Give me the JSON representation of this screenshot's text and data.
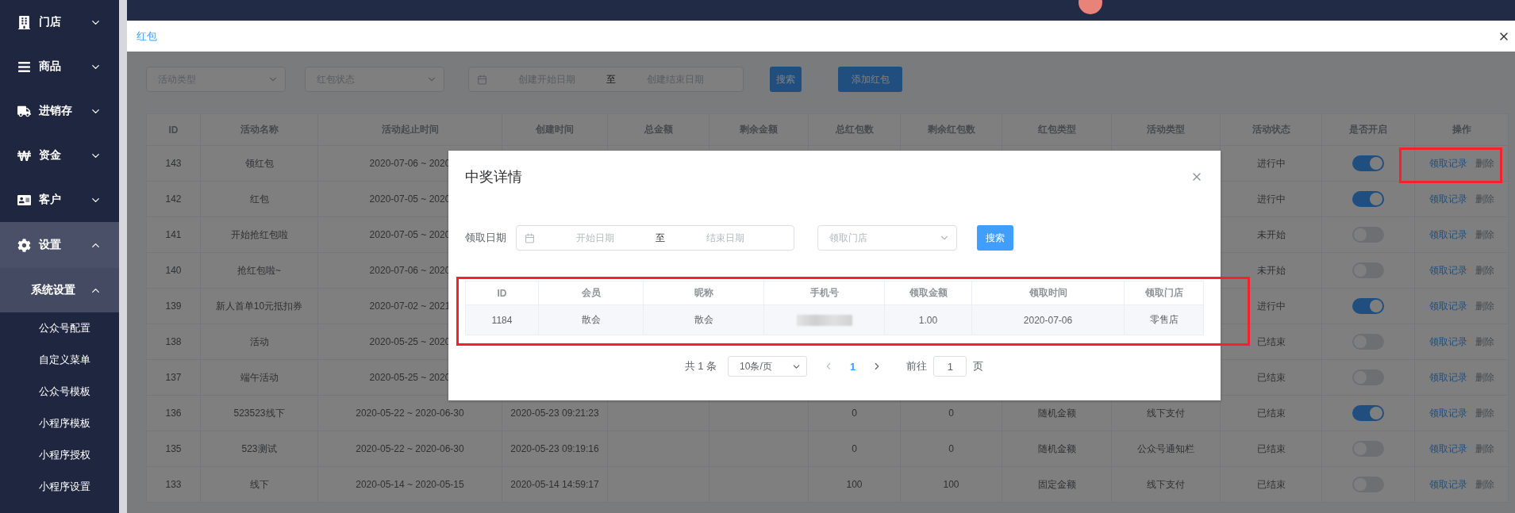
{
  "sidebar": {
    "items": [
      {
        "label": "门店",
        "expanded": false
      },
      {
        "label": "商品",
        "expanded": false
      },
      {
        "label": "进销存",
        "expanded": false
      },
      {
        "label": "资金",
        "expanded": false
      },
      {
        "label": "客户",
        "expanded": false
      },
      {
        "label": "设置",
        "expanded": true,
        "children": [
          {
            "label": "系统设置",
            "expanded": true,
            "children": [
              {
                "label": "公众号配置"
              },
              {
                "label": "自定义菜单"
              },
              {
                "label": "公众号模板"
              },
              {
                "label": "小程序模板"
              },
              {
                "label": "小程序授权"
              },
              {
                "label": "小程序设置"
              }
            ]
          }
        ]
      }
    ]
  },
  "page_title": "红包",
  "filters": {
    "activity_type": {
      "placeholder": "活动类型"
    },
    "packet_status": {
      "placeholder": "红包状态"
    },
    "date_range": {
      "start_placeholder": "创建开始日期",
      "separator": "至",
      "end_placeholder": "创建结束日期"
    },
    "buttons": [
      "搜索",
      "添加红包"
    ]
  },
  "table": {
    "columns": [
      "ID",
      "活动名称",
      "活动起止时间",
      "创建时间",
      "总金额",
      "剩余金额",
      "总红包数",
      "剩余红包数",
      "红包类型",
      "活动类型",
      "活动状态",
      "是否开启",
      "操作"
    ],
    "rows": [
      {
        "cells": [
          "143",
          "领红包",
          "2020-07-06 ~ 2020",
          null,
          null,
          null,
          null,
          null,
          null,
          null,
          "进行中"
        ],
        "enabled": true,
        "actions": [
          "领取记录",
          "删除"
        ]
      },
      {
        "cells": [
          "142",
          "红包",
          "2020-07-05 ~ 2020",
          null,
          null,
          null,
          null,
          null,
          null,
          null,
          "进行中"
        ],
        "enabled": true,
        "actions": [
          "领取记录",
          "删除"
        ]
      },
      {
        "cells": [
          "141",
          "开始抢红包啦",
          "2020-07-05 ~ 2020",
          null,
          null,
          null,
          null,
          null,
          null,
          null,
          "未开始"
        ],
        "enabled": false,
        "actions": [
          "领取记录",
          "删除"
        ]
      },
      {
        "cells": [
          "140",
          "抢红包啦~",
          "2020-07-06 ~ 2020",
          null,
          null,
          null,
          null,
          null,
          null,
          null,
          "未开始"
        ],
        "enabled": false,
        "actions": [
          "领取记录",
          "删除"
        ]
      },
      {
        "cells": [
          "139",
          "新人首单10元抵扣券",
          "2020-07-02 ~ 2021",
          null,
          null,
          null,
          null,
          null,
          null,
          null,
          "进行中"
        ],
        "enabled": true,
        "actions": [
          "领取记录",
          "删除"
        ]
      },
      {
        "cells": [
          "138",
          "活动",
          "2020-05-25 ~ 2020",
          null,
          null,
          null,
          null,
          null,
          null,
          null,
          "已结束"
        ],
        "enabled": false,
        "actions": [
          "领取记录",
          "删除"
        ]
      },
      {
        "cells": [
          "137",
          "端午活动",
          "2020-05-25 ~ 2020",
          null,
          null,
          null,
          null,
          null,
          null,
          null,
          "已结束"
        ],
        "enabled": false,
        "actions": [
          "领取记录",
          "删除"
        ]
      },
      {
        "cells": [
          "136",
          "523523线下",
          "2020-05-22 ~ 2020-06-30",
          "2020-05-23 09:21:23",
          null,
          null,
          "0",
          "0",
          "随机金额",
          "线下支付",
          "已结束"
        ],
        "enabled": true,
        "actions": [
          "领取记录",
          "删除"
        ]
      },
      {
        "cells": [
          "135",
          "523测试",
          "2020-05-22 ~ 2020-06-30",
          "2020-05-23 09:19:16",
          null,
          null,
          "0",
          "0",
          "随机金额",
          "公众号通知栏",
          "已结束"
        ],
        "enabled": false,
        "actions": [
          "领取记录",
          "删除"
        ]
      },
      {
        "cells": [
          "133",
          "线下",
          "2020-05-14 ~ 2020-05-15",
          "2020-05-14 14:59:17",
          null,
          null,
          "100",
          "100",
          "固定金额",
          "线下支付",
          "已结束"
        ],
        "enabled": false,
        "actions": [
          "领取记录",
          "删除"
        ]
      }
    ]
  },
  "modal": {
    "title": "中奖详情",
    "date_label": "领取日期",
    "date_range": {
      "start_placeholder": "开始日期",
      "separator": "至",
      "end_placeholder": "结束日期"
    },
    "store_select": {
      "placeholder": "领取门店"
    },
    "search_button": "搜索",
    "table": {
      "columns": [
        "ID",
        "会员",
        "昵称",
        "手机号",
        "领取金额",
        "领取时间",
        "领取门店"
      ],
      "rows": [
        {
          "cells": [
            "1184",
            "散会",
            "散会",
            null,
            "1.00",
            "2020-07-06",
            "零售店"
          ]
        }
      ]
    },
    "pagination": {
      "total": "共 1 条",
      "page_size": "10条/页",
      "pages": [
        {
          "label": "1",
          "selected": true
        }
      ],
      "goto_label": "前往",
      "goto_value": "1",
      "goto_suffix": "页"
    }
  }
}
